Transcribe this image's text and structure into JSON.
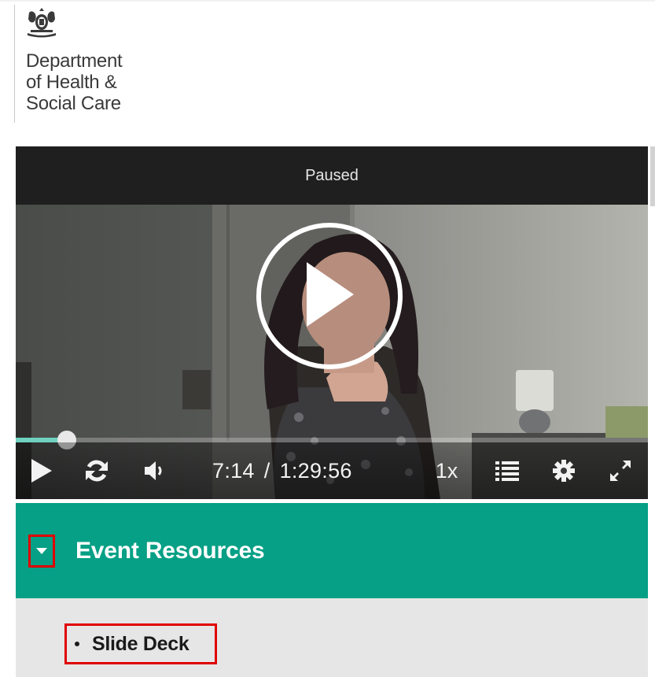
{
  "brand": {
    "lines": [
      "Department",
      "of Health &",
      "Social Care"
    ]
  },
  "player": {
    "status": "Paused",
    "current_time": "7:14",
    "separator": "/",
    "duration": "1:29:56",
    "playback_rate": "1x",
    "progress_fraction": 0.081,
    "accent_color": "#6fd1c0"
  },
  "accordion": {
    "title": "Event Resources",
    "color": "#05a085",
    "items": [
      {
        "label": "Slide Deck"
      }
    ]
  }
}
